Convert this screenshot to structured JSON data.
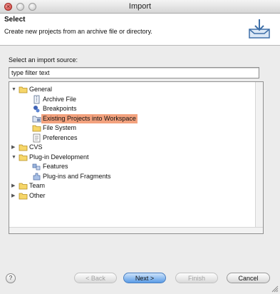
{
  "window": {
    "title": "Import"
  },
  "banner": {
    "heading": "Select",
    "description": "Create new projects from an archive file or directory.",
    "icon": "import-wizard-icon"
  },
  "source": {
    "label": "Select an import source:",
    "filter_value": "type filter text"
  },
  "tree": {
    "items": [
      {
        "label": "General",
        "icon": "folder-icon",
        "expanded": true,
        "level": 0
      },
      {
        "label": "Archive File",
        "icon": "archive-file-icon",
        "level": 1
      },
      {
        "label": "Breakpoints",
        "icon": "breakpoints-icon",
        "level": 1
      },
      {
        "label": "Existing Projects into Workspace",
        "icon": "project-icon",
        "level": 1,
        "selected": true
      },
      {
        "label": "File System",
        "icon": "file-system-folder-icon",
        "level": 1
      },
      {
        "label": "Preferences",
        "icon": "preferences-icon",
        "level": 1
      },
      {
        "label": "CVS",
        "icon": "folder-icon",
        "expanded": false,
        "level": 0
      },
      {
        "label": "Plug-in Development",
        "icon": "folder-icon",
        "expanded": true,
        "level": 0
      },
      {
        "label": "Features",
        "icon": "features-icon",
        "level": 1
      },
      {
        "label": "Plug-ins and Fragments",
        "icon": "plugins-icon",
        "level": 1
      },
      {
        "label": "Team",
        "icon": "folder-icon",
        "expanded": false,
        "level": 0
      },
      {
        "label": "Other",
        "icon": "folder-icon",
        "expanded": false,
        "level": 0
      }
    ]
  },
  "buttons": {
    "help": "?",
    "back": "< Back",
    "next": "Next >",
    "finish": "Finish",
    "cancel": "Cancel"
  },
  "colors": {
    "selection": "#f3a27e",
    "primary_button": "#5b9ce6"
  }
}
